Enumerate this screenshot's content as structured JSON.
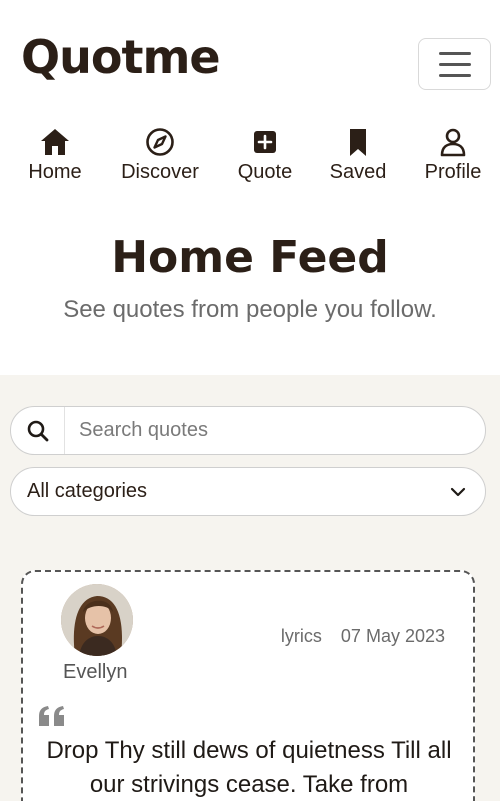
{
  "app": {
    "brand": "Quotme"
  },
  "nav": {
    "items": [
      {
        "label": "Home",
        "icon": "home-icon"
      },
      {
        "label": "Discover",
        "icon": "compass-icon"
      },
      {
        "label": "Quote",
        "icon": "plus-square-icon"
      },
      {
        "label": "Saved",
        "icon": "bookmark-icon"
      },
      {
        "label": "Profile",
        "icon": "user-icon"
      }
    ]
  },
  "hero": {
    "title": "Home Feed",
    "subtitle": "See quotes from people you follow."
  },
  "search": {
    "placeholder": "Search quotes",
    "value": "",
    "icon": "search-icon"
  },
  "filter": {
    "selected": "All categories",
    "icon": "chevron-down-icon"
  },
  "feed": {
    "quotes": [
      {
        "author": "Evellyn",
        "category": "lyrics",
        "date": "07 May 2023",
        "text": "Drop Thy still dews of quietness Till all our strivings cease. Take from",
        "quote_icon": "quote-icon"
      }
    ]
  },
  "colors": {
    "brand": "#2b1f17",
    "feed_background": "#f6f4ef",
    "muted_text": "#6b6b6b"
  }
}
